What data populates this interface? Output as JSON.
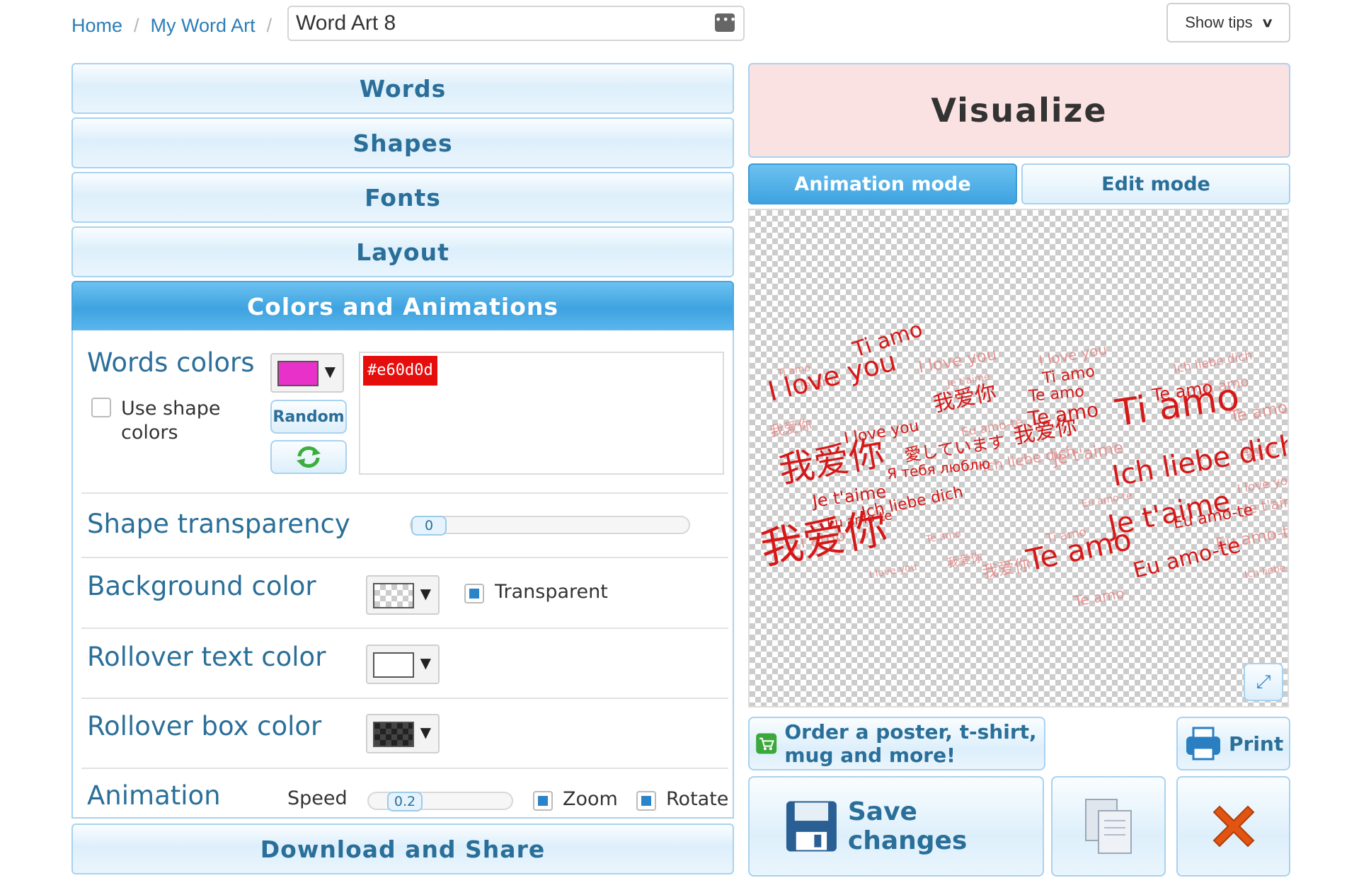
{
  "breadcrumb": {
    "home": "Home",
    "my_word_art": "My Word Art",
    "sep": "/"
  },
  "title": {
    "value": "Word Art 8"
  },
  "tips": {
    "label": "Show tips",
    "icon": "chevron-down-icon"
  },
  "accordion": {
    "words": "Words",
    "shapes": "Shapes",
    "fonts": "Fonts",
    "layout": "Layout",
    "colors": "Colors and Animations",
    "download": "Download and Share"
  },
  "colors_panel": {
    "words_colors_label": "Words colors",
    "words_color_swatch": "#e831c9",
    "use_shape_colors": "Use shape colors",
    "random_button": "Random",
    "color_list": [
      "#e60d0d"
    ],
    "shape_transparency_label": "Shape transparency",
    "shape_transparency_value": "0",
    "background_label": "Background color",
    "transparent_label": "Transparent",
    "rollover_text_label": "Rollover text color",
    "rollover_text_swatch": "#ffffff",
    "rollover_box_label": "Rollover box color",
    "animation_label": "Animation",
    "speed_label": "Speed",
    "speed_value": "0.2",
    "zoom_label": "Zoom",
    "rotate_label": "Rotate"
  },
  "right": {
    "visualize": "Visualize",
    "animation_mode": "Animation mode",
    "edit_mode": "Edit mode",
    "order": "Order a poster, t-shirt, mug and more!",
    "print": "Print",
    "save": "Save changes"
  },
  "wordcloud_words": [
    {
      "t": "Ti amo",
      "size": 30
    },
    {
      "t": "I love you",
      "size": 38
    },
    {
      "t": "我爱你",
      "size": 50
    },
    {
      "t": "Je t'aime",
      "size": 24
    },
    {
      "t": "Ich liebe dich",
      "size": 22
    },
    {
      "t": "我爱你",
      "size": 60
    },
    {
      "t": "Te amo",
      "size": 22
    },
    {
      "t": "I love you",
      "size": 22
    },
    {
      "t": "我爱你",
      "size": 30
    },
    {
      "t": "Я тебя люблю",
      "size": 20
    },
    {
      "t": "Eu amo-te",
      "size": 18
    },
    {
      "t": "Ti amo",
      "size": 52
    },
    {
      "t": "Ich liebe dich",
      "size": 40
    },
    {
      "t": "Je t'aime",
      "size": 40
    },
    {
      "t": "Te amo",
      "size": 42
    },
    {
      "t": "Eu amo-te",
      "size": 30
    },
    {
      "t": "我爱你",
      "size": 30
    },
    {
      "t": "Te amo",
      "size": 28
    },
    {
      "t": "愛しています",
      "size": 24
    },
    {
      "t": "Ti amo",
      "size": 22
    },
    {
      "t": "Eu amo-te",
      "size": 22
    },
    {
      "t": "Te amo",
      "size": 24
    }
  ]
}
